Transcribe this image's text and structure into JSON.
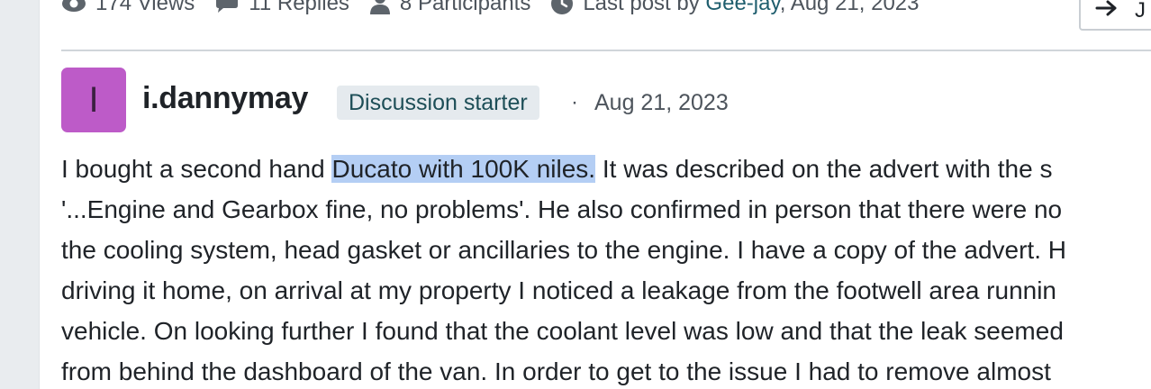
{
  "thread_stats": {
    "views": "174 Views",
    "replies": "11 Replies",
    "participants": "8 Participants",
    "last_post_prefix": "Last post by",
    "last_post_author": "Gee-jay",
    "last_post_date": ", Aug 21, 2023"
  },
  "jump_button": {
    "label": "J"
  },
  "post": {
    "avatar_letter": "I",
    "username": "i.dannymay",
    "badge": "Discussion starter",
    "separator": "·",
    "date": "Aug 21, 2023",
    "lines": [
      {
        "before": "I bought a second hand ",
        "highlight": "Ducato with 100K niles.",
        "after": " It was described on the advert with the s"
      },
      {
        "text": "'...Engine and Gearbox fine, no problems'. He also confirmed in person that there were no"
      },
      {
        "text": "the cooling system, head gasket or ancillaries to the engine. I have a copy of the advert. H"
      },
      {
        "text": "driving it home, on arrival at my property I noticed a leakage from the footwell area runnin"
      },
      {
        "text": "vehicle. On looking further I found that the coolant level was low and that the leak seemed"
      },
      {
        "text": "from behind the dashboard of the van. In order to get to the issue I had to remove almost"
      }
    ]
  },
  "colors": {
    "avatar_bg": "#bd5bc8",
    "badge_bg": "#e5eaee",
    "badge_text": "#1d4e57",
    "link": "#1f5e6e",
    "selection": "#b4cef4"
  }
}
